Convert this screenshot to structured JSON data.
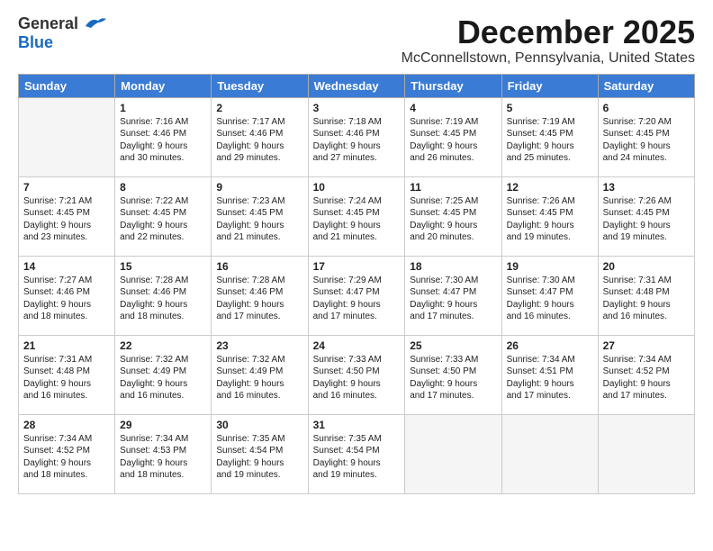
{
  "header": {
    "logo_general": "General",
    "logo_blue": "Blue",
    "month_title": "December 2025",
    "location": "McConnellstown, Pennsylvania, United States"
  },
  "days_of_week": [
    "Sunday",
    "Monday",
    "Tuesday",
    "Wednesday",
    "Thursday",
    "Friday",
    "Saturday"
  ],
  "weeks": [
    [
      {
        "day": "",
        "empty": true
      },
      {
        "day": "1",
        "sunrise": "7:16 AM",
        "sunset": "4:46 PM",
        "daylight": "9 hours and 30 minutes."
      },
      {
        "day": "2",
        "sunrise": "7:17 AM",
        "sunset": "4:46 PM",
        "daylight": "9 hours and 29 minutes."
      },
      {
        "day": "3",
        "sunrise": "7:18 AM",
        "sunset": "4:46 PM",
        "daylight": "9 hours and 27 minutes."
      },
      {
        "day": "4",
        "sunrise": "7:19 AM",
        "sunset": "4:45 PM",
        "daylight": "9 hours and 26 minutes."
      },
      {
        "day": "5",
        "sunrise": "7:19 AM",
        "sunset": "4:45 PM",
        "daylight": "9 hours and 25 minutes."
      },
      {
        "day": "6",
        "sunrise": "7:20 AM",
        "sunset": "4:45 PM",
        "daylight": "9 hours and 24 minutes."
      }
    ],
    [
      {
        "day": "7",
        "sunrise": "7:21 AM",
        "sunset": "4:45 PM",
        "daylight": "9 hours and 23 minutes."
      },
      {
        "day": "8",
        "sunrise": "7:22 AM",
        "sunset": "4:45 PM",
        "daylight": "9 hours and 22 minutes."
      },
      {
        "day": "9",
        "sunrise": "7:23 AM",
        "sunset": "4:45 PM",
        "daylight": "9 hours and 21 minutes."
      },
      {
        "day": "10",
        "sunrise": "7:24 AM",
        "sunset": "4:45 PM",
        "daylight": "9 hours and 21 minutes."
      },
      {
        "day": "11",
        "sunrise": "7:25 AM",
        "sunset": "4:45 PM",
        "daylight": "9 hours and 20 minutes."
      },
      {
        "day": "12",
        "sunrise": "7:26 AM",
        "sunset": "4:45 PM",
        "daylight": "9 hours and 19 minutes."
      },
      {
        "day": "13",
        "sunrise": "7:26 AM",
        "sunset": "4:45 PM",
        "daylight": "9 hours and 19 minutes."
      }
    ],
    [
      {
        "day": "14",
        "sunrise": "7:27 AM",
        "sunset": "4:46 PM",
        "daylight": "9 hours and 18 minutes."
      },
      {
        "day": "15",
        "sunrise": "7:28 AM",
        "sunset": "4:46 PM",
        "daylight": "9 hours and 18 minutes."
      },
      {
        "day": "16",
        "sunrise": "7:28 AM",
        "sunset": "4:46 PM",
        "daylight": "9 hours and 17 minutes."
      },
      {
        "day": "17",
        "sunrise": "7:29 AM",
        "sunset": "4:47 PM",
        "daylight": "9 hours and 17 minutes."
      },
      {
        "day": "18",
        "sunrise": "7:30 AM",
        "sunset": "4:47 PM",
        "daylight": "9 hours and 17 minutes."
      },
      {
        "day": "19",
        "sunrise": "7:30 AM",
        "sunset": "4:47 PM",
        "daylight": "9 hours and 16 minutes."
      },
      {
        "day": "20",
        "sunrise": "7:31 AM",
        "sunset": "4:48 PM",
        "daylight": "9 hours and 16 minutes."
      }
    ],
    [
      {
        "day": "21",
        "sunrise": "7:31 AM",
        "sunset": "4:48 PM",
        "daylight": "9 hours and 16 minutes."
      },
      {
        "day": "22",
        "sunrise": "7:32 AM",
        "sunset": "4:49 PM",
        "daylight": "9 hours and 16 minutes."
      },
      {
        "day": "23",
        "sunrise": "7:32 AM",
        "sunset": "4:49 PM",
        "daylight": "9 hours and 16 minutes."
      },
      {
        "day": "24",
        "sunrise": "7:33 AM",
        "sunset": "4:50 PM",
        "daylight": "9 hours and 16 minutes."
      },
      {
        "day": "25",
        "sunrise": "7:33 AM",
        "sunset": "4:50 PM",
        "daylight": "9 hours and 17 minutes."
      },
      {
        "day": "26",
        "sunrise": "7:34 AM",
        "sunset": "4:51 PM",
        "daylight": "9 hours and 17 minutes."
      },
      {
        "day": "27",
        "sunrise": "7:34 AM",
        "sunset": "4:52 PM",
        "daylight": "9 hours and 17 minutes."
      }
    ],
    [
      {
        "day": "28",
        "sunrise": "7:34 AM",
        "sunset": "4:52 PM",
        "daylight": "9 hours and 18 minutes."
      },
      {
        "day": "29",
        "sunrise": "7:34 AM",
        "sunset": "4:53 PM",
        "daylight": "9 hours and 18 minutes."
      },
      {
        "day": "30",
        "sunrise": "7:35 AM",
        "sunset": "4:54 PM",
        "daylight": "9 hours and 19 minutes."
      },
      {
        "day": "31",
        "sunrise": "7:35 AM",
        "sunset": "4:54 PM",
        "daylight": "9 hours and 19 minutes."
      },
      {
        "day": "",
        "empty": true
      },
      {
        "day": "",
        "empty": true
      },
      {
        "day": "",
        "empty": true
      }
    ]
  ],
  "labels": {
    "sunrise_prefix": "Sunrise: ",
    "sunset_prefix": "Sunset: ",
    "daylight_prefix": "Daylight: "
  }
}
